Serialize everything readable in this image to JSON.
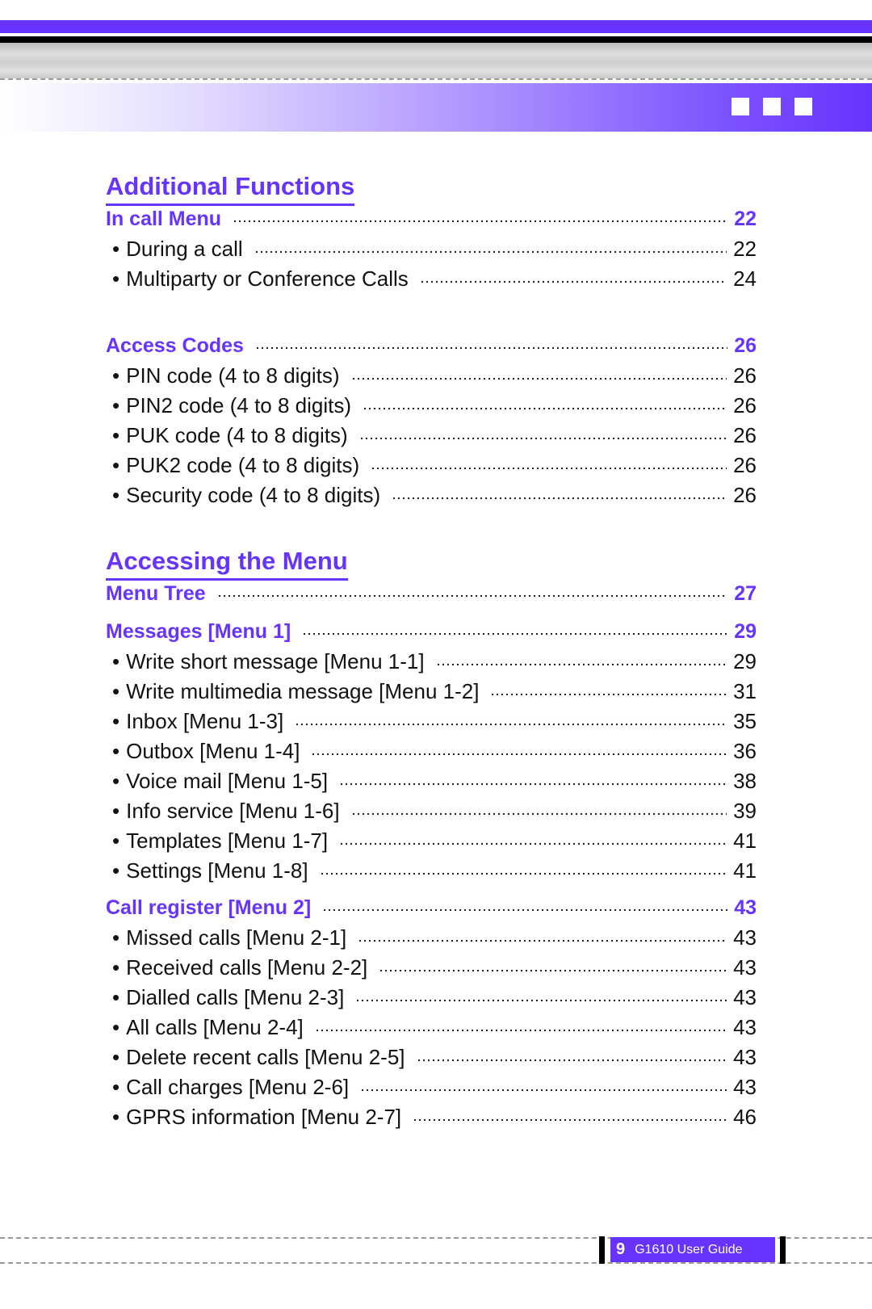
{
  "header": {
    "decor_squares": 3,
    "accent_color": "#6633ff"
  },
  "sections": [
    {
      "title": "Additional Functions",
      "entries": [
        {
          "type": "section",
          "label": "In call Menu",
          "page": "22"
        },
        {
          "type": "item",
          "label": "During a call",
          "page": "22"
        },
        {
          "type": "item",
          "label": "Multiparty or Conference Calls",
          "page": "24"
        },
        {
          "type": "section",
          "label": "Access Codes",
          "page": "26"
        },
        {
          "type": "item",
          "label": "PIN code (4 to 8 digits)",
          "page": "26"
        },
        {
          "type": "item",
          "label": "PIN2 code (4 to 8 digits)",
          "page": "26"
        },
        {
          "type": "item",
          "label": "PUK code (4 to 8 digits)",
          "page": "26"
        },
        {
          "type": "item",
          "label": "PUK2 code (4 to 8 digits)",
          "page": "26"
        },
        {
          "type": "item",
          "label": "Security code (4 to 8 digits)",
          "page": "26"
        }
      ]
    },
    {
      "title": "Accessing the Menu",
      "entries": [
        {
          "type": "section",
          "label": "Menu Tree",
          "page": "27"
        },
        {
          "type": "section",
          "label": "Messages [Menu 1]",
          "page": "29"
        },
        {
          "type": "item",
          "label": "Write short message [Menu 1-1]",
          "page": "29"
        },
        {
          "type": "item",
          "label": "Write multimedia message [Menu 1-2]",
          "page": "31"
        },
        {
          "type": "item",
          "label": "Inbox [Menu 1-3]",
          "page": "35"
        },
        {
          "type": "item",
          "label": "Outbox [Menu 1-4]",
          "page": "36"
        },
        {
          "type": "item",
          "label": "Voice mail [Menu 1-5]",
          "page": "38"
        },
        {
          "type": "item",
          "label": "Info service [Menu 1-6]",
          "page": "39"
        },
        {
          "type": "item",
          "label": "Templates [Menu 1-7]",
          "page": "41"
        },
        {
          "type": "item",
          "label": "Settings [Menu 1-8]",
          "page": "41"
        },
        {
          "type": "section",
          "label": "Call register [Menu 2]",
          "page": "43"
        },
        {
          "type": "item",
          "label": "Missed calls [Menu 2-1]",
          "page": "43"
        },
        {
          "type": "item",
          "label": "Received calls [Menu 2-2]",
          "page": "43"
        },
        {
          "type": "item",
          "label": "Dialled calls [Menu 2-3]",
          "page": "43"
        },
        {
          "type": "item",
          "label": "All calls [Menu 2-4]",
          "page": "43"
        },
        {
          "type": "item",
          "label": "Delete recent calls [Menu 2-5]",
          "page": "43"
        },
        {
          "type": "item",
          "label": "Call charges [Menu 2-6]",
          "page": "43"
        },
        {
          "type": "item",
          "label": "GPRS information [Menu 2-7]",
          "page": "46"
        }
      ]
    }
  ],
  "bullet": "•",
  "footer": {
    "page_number": "9",
    "guide_title": "G1610 User Guide"
  }
}
